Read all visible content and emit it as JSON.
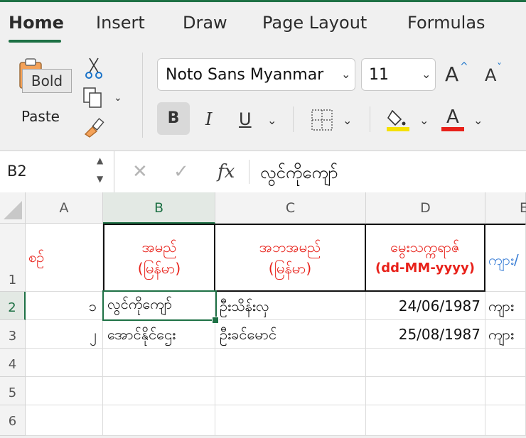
{
  "tabs": [
    "Home",
    "Insert",
    "Draw",
    "Page Layout",
    "Formulas"
  ],
  "ribbon": {
    "tooltip": "Bold",
    "paste_label": "Paste",
    "font_name": "Noto Sans Myanmar",
    "font_size": "11",
    "bold_label": "B",
    "italic_label": "I",
    "underline_label": "U",
    "grow_label": "A",
    "shrink_label": "A",
    "font_color_label": "A",
    "fill_color": "#f5e100",
    "font_color": "#e8211a"
  },
  "formula_bar": {
    "name_box": "B2",
    "fx_label": "fx",
    "value": "လွင်ကိုကျော်"
  },
  "sheet": {
    "columns": [
      "A",
      "B",
      "C",
      "D",
      "E"
    ],
    "rows": [
      "1",
      "2",
      "3",
      "4",
      "5",
      "6"
    ],
    "header_row": {
      "a": "စဉ်",
      "b1": "အမည်",
      "b2": "(မြန်မာ)",
      "c1": "အဘအမည်",
      "c2": "(မြန်မာ)",
      "d1": "မွေးသက္ကရာဇ်",
      "d2": "(dd-MM-yyyy)",
      "e": "ကျား/"
    },
    "data_rows": [
      {
        "a": "၁",
        "b": "လွင်ကိုကျော်",
        "c": "ဦးသိန်းလှ",
        "d": "24/06/1987",
        "e": "ကျား"
      },
      {
        "a": "၂",
        "b": "အောင်နိုင်ဌေး",
        "c": "ဦးခင်မောင်",
        "d": "25/08/1987",
        "e": "ကျား"
      }
    ],
    "selected_cell": "B2"
  }
}
